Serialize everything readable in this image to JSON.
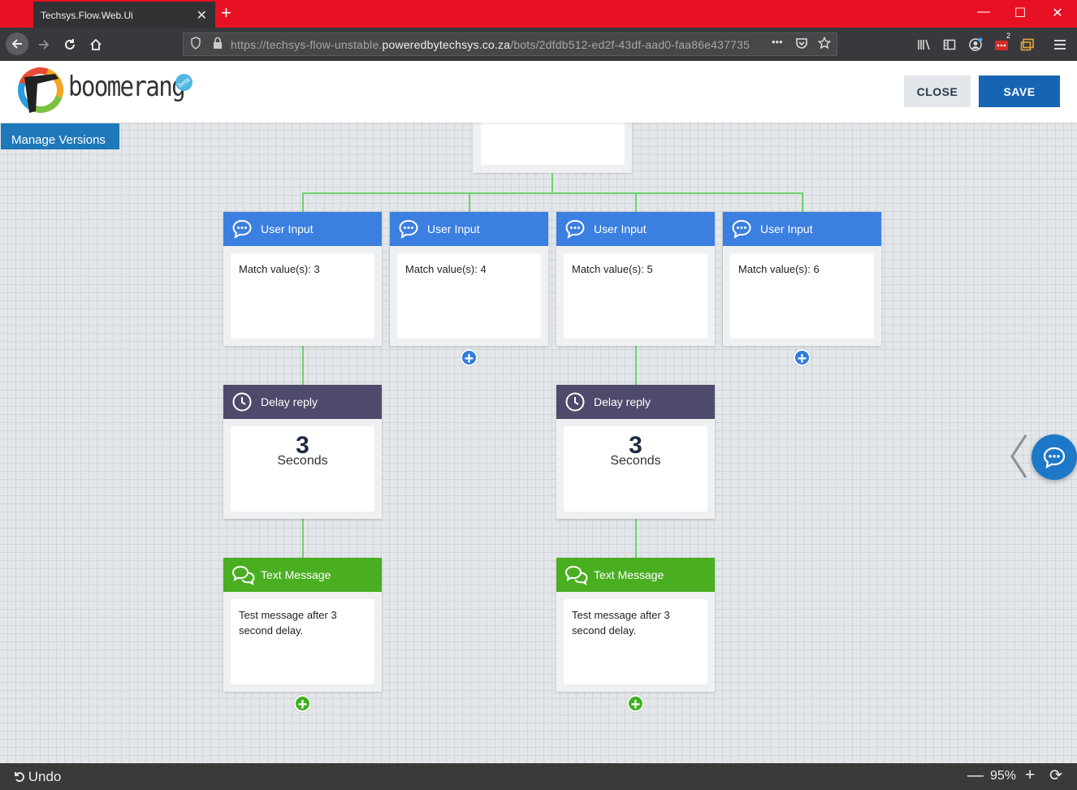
{
  "browser": {
    "tab_title": "Techsys.Flow.Web.Ui",
    "tab_close": "✕",
    "new_tab": "+",
    "url_prefix": "https://techsys-flow-unstable.",
    "url_host": "poweredbytechsys.co.za",
    "url_path": "/bots/2dfdb512-ed2f-43df-aad0-faa86e437735",
    "url_more": "•••",
    "notification_count": "2",
    "window_controls": {
      "minimize": "—",
      "maximize": "☐",
      "close": "✕"
    }
  },
  "header": {
    "logo_text": "boomerang",
    "logo_badge": "beta",
    "close_label": "CLOSE",
    "save_label": "SAVE"
  },
  "manage_versions": "Manage Versions",
  "nodes": {
    "input_3": {
      "title": "User Input",
      "body": "Match value(s): 3"
    },
    "input_4": {
      "title": "User Input",
      "body": "Match value(s): 4"
    },
    "input_5": {
      "title": "User Input",
      "body": "Match value(s): 5"
    },
    "input_6": {
      "title": "User Input",
      "body": "Match value(s): 6"
    },
    "delay_left": {
      "title": "Delay reply",
      "value": "3",
      "unit": "Seconds"
    },
    "delay_right": {
      "title": "Delay reply",
      "value": "3",
      "unit": "Seconds"
    },
    "text_left": {
      "title": "Text Message",
      "body": "Test message after 3 second delay."
    },
    "text_right": {
      "title": "Text Message",
      "body": "Test message after 3 second delay."
    }
  },
  "add_symbol": "+",
  "bottom": {
    "undo_label": "Undo",
    "zoom_out": "—",
    "zoom_value": "95%",
    "zoom_in": "+",
    "refresh": "⟳"
  },
  "colors": {
    "titlebar": "#e81123",
    "user_input_header": "#3b7fe0",
    "delay_header": "#4e4a6c",
    "text_message_header": "#4aae21",
    "connector": "#6dd36d",
    "save_button": "#1565b4"
  }
}
